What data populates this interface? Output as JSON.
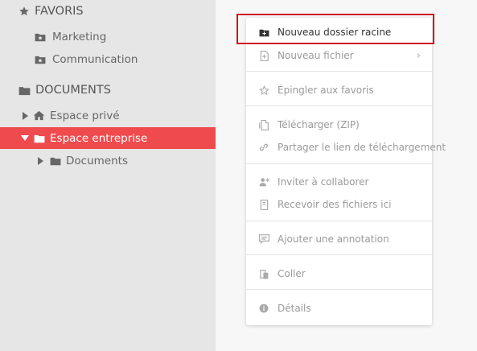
{
  "sidebar": {
    "favoris_title": "FAVORIS",
    "favoris_items": [
      "Marketing",
      "Communication"
    ],
    "documents_title": "DOCUMENTS",
    "tree": [
      "Espace privé",
      "Espace entreprise",
      "Documents"
    ]
  },
  "menu": {
    "items": [
      "Nouveau dossier racine",
      "Nouveau fichier",
      "Épingler aux favoris",
      "Télécharger (ZIP)",
      "Partager le lien de téléchargement",
      "Inviter à collaborer",
      "Recevoir des fichiers ici",
      "Ajouter une annotation",
      "Coller",
      "Détails"
    ],
    "submenu_arrow": "›"
  },
  "icons": {
    "star": "star-icon",
    "folder_star": "folder-star-icon",
    "folder": "folder-icon",
    "home": "home-icon",
    "caret_right": "caret-right-icon",
    "caret_down": "caret-down-icon",
    "folder_plus": "folder-plus-icon",
    "file_plus": "file-plus-icon",
    "pin_star": "star-outline-icon",
    "download": "download-icon",
    "link": "link-icon",
    "invite": "user-plus-icon",
    "receive": "inbox-icon",
    "annotation": "comment-icon",
    "paste": "paste-icon",
    "info": "info-icon"
  },
  "colors": {
    "accent": "#ef4a4d",
    "highlight_border": "#d0161c",
    "sidebar_bg": "#e6e6e6",
    "main_bg": "#f7f7f7"
  }
}
